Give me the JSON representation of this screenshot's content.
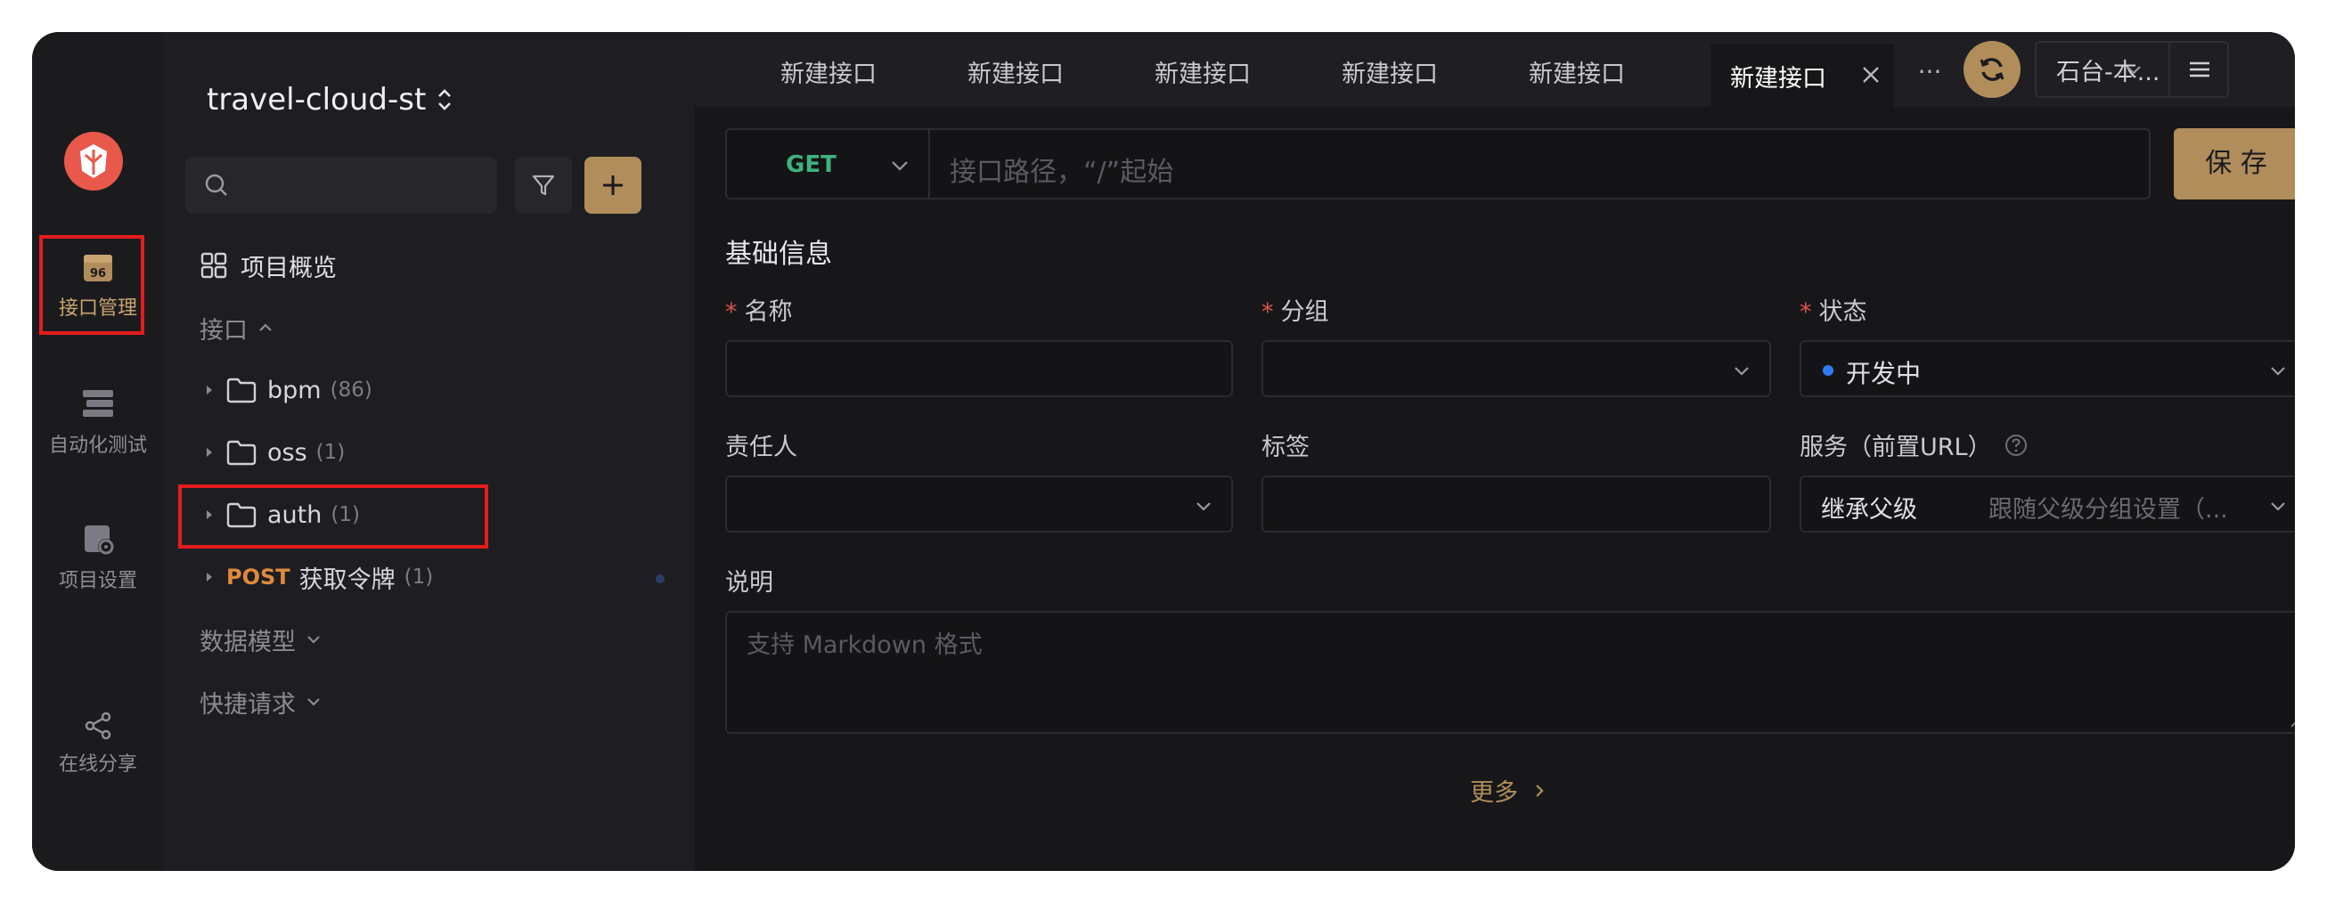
{
  "window": {
    "traffic_lights": [
      "#fe5f57",
      "#febc2e",
      "#28c840"
    ]
  },
  "rail": {
    "items": [
      {
        "label": "接口管理",
        "icon": "api-calendar-icon",
        "active": true
      },
      {
        "label": "自动化测试",
        "icon": "automation-icon"
      },
      {
        "label": "项目设置",
        "icon": "project-settings-icon"
      },
      {
        "label": "在线分享",
        "icon": "share-icon"
      }
    ]
  },
  "sidebar": {
    "project_name": "travel-cloud-st",
    "search_placeholder": "",
    "overview_label": "项目概览",
    "section_label": "接口",
    "folders": [
      {
        "name": "bpm",
        "count": "(86)"
      },
      {
        "name": "oss",
        "count": "(1)"
      },
      {
        "name": "auth",
        "count": "(1)"
      }
    ],
    "endpoint": {
      "method": "POST",
      "name": "获取令牌",
      "count": "(1)"
    },
    "data_models_label": "数据模型",
    "quick_requests_label": "快捷请求"
  },
  "tabs": [
    {
      "label": "新建接口"
    },
    {
      "label": "新建接口"
    },
    {
      "label": "新建接口"
    },
    {
      "label": "新建接口"
    },
    {
      "label": "新建接口"
    },
    {
      "label": "新建接口",
      "active": true
    }
  ],
  "topbar": {
    "more_label": "···",
    "env_label": "石台-本..."
  },
  "request": {
    "method": "GET",
    "path_placeholder": "接口路径，“/”起始",
    "save_label": "保 存"
  },
  "basic_info": {
    "title": "基础信息",
    "name_label": "名称",
    "group_label": "分组",
    "status_label": "状态",
    "status_value": "开发中",
    "owner_label": "责任人",
    "tags_label": "标签",
    "service_label": "服务（前置URL）",
    "service_value": "继承父级",
    "service_hint": "跟随父级分组设置（...",
    "desc_label": "说明",
    "desc_placeholder": "支持 Markdown 格式",
    "more_label": "更多"
  },
  "colors": {
    "accent": "#b08d5b",
    "get": "#3fb27f",
    "post": "#e08a3c",
    "status_dot": "#2f7bf5",
    "highlight": "#e51c1c"
  }
}
